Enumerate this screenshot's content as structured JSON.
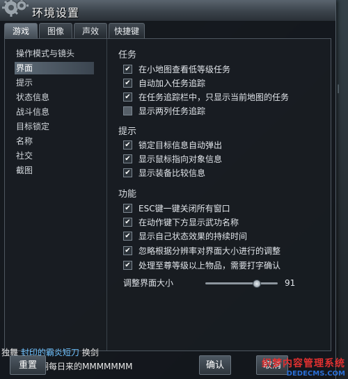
{
  "window": {
    "title": "环境设置"
  },
  "tabs": [
    {
      "label": "游戏",
      "active": true
    },
    {
      "label": "图像",
      "active": false
    },
    {
      "label": "声效",
      "active": false
    },
    {
      "label": "快捷键",
      "active": false
    }
  ],
  "nav": [
    {
      "label": "操作模式与镜头",
      "selected": false
    },
    {
      "label": "界面",
      "selected": true
    },
    {
      "label": "提示",
      "selected": false
    },
    {
      "label": "状态信息",
      "selected": false
    },
    {
      "label": "战斗信息",
      "selected": false
    },
    {
      "label": "目标锁定",
      "selected": false
    },
    {
      "label": "名称",
      "selected": false
    },
    {
      "label": "社交",
      "selected": false
    },
    {
      "label": "截图",
      "selected": false
    }
  ],
  "sections": {
    "task": {
      "title": "任务",
      "options": [
        {
          "label": "在小地图查看低等级任务",
          "checked": true
        },
        {
          "label": "自动加入任务追踪",
          "checked": true
        },
        {
          "label": "在任务追踪栏中，只显示当前地图的任务",
          "checked": true
        },
        {
          "label": "显示两列任务追踪",
          "checked": false
        }
      ]
    },
    "hint": {
      "title": "提示",
      "options": [
        {
          "label": "锁定目标信息自动弹出",
          "checked": true
        },
        {
          "label": "显示鼠标指向对象信息",
          "checked": true
        },
        {
          "label": "显示装备比较信息",
          "checked": true
        }
      ]
    },
    "function": {
      "title": "功能",
      "options": [
        {
          "label": "ESC键一键关闭所有窗口",
          "checked": true
        },
        {
          "label": "在动作键下方显示武功名称",
          "checked": true
        },
        {
          "label": "显示自己状态效果的持续时间",
          "checked": true
        },
        {
          "label": "忽略根据分辨率对界面大小进行的调整",
          "checked": true
        },
        {
          "label": "处理至尊等级以上物品，需要打字确认",
          "checked": true
        }
      ],
      "slider": {
        "label": "调整界面大小",
        "value": "91"
      }
    }
  },
  "buttons": {
    "reset": "重置",
    "confirm": "确认",
    "cancel": "取消"
  },
  "background_chat": {
    "line1_prefix": "独舞",
    "line1_link": "封印的霸炎短刀",
    "line1_suffix": "换剑",
    "line2": "洞每日来的MMMMMMM"
  },
  "watermark": {
    "line1": "织梦内容管理系统",
    "line2": "DEDECMS.COM"
  }
}
